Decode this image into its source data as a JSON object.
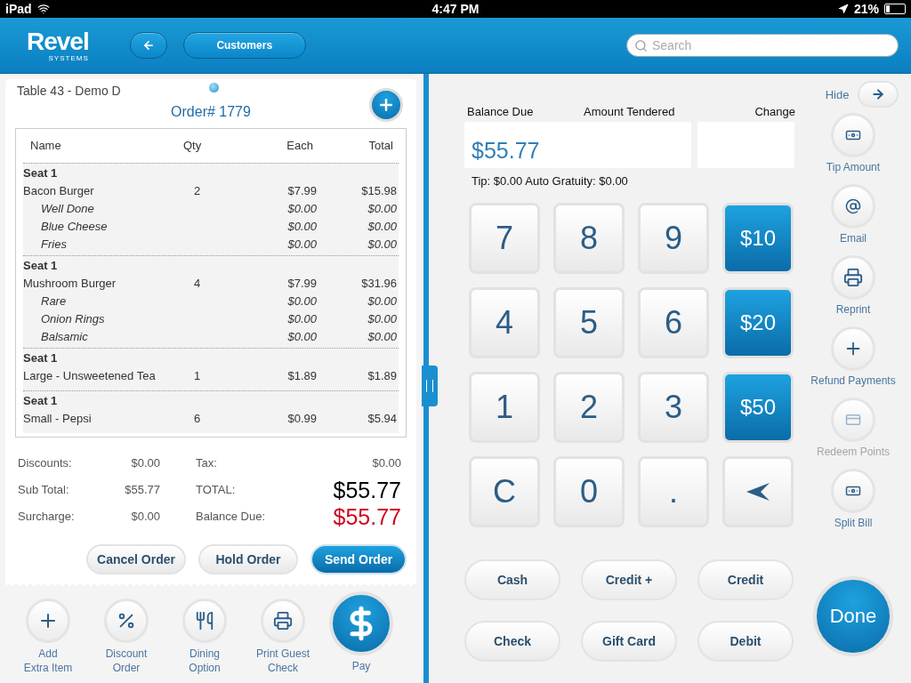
{
  "status_bar": {
    "device": "iPad",
    "time": "4:47 PM",
    "battery": "21%"
  },
  "header": {
    "logo": "Revel",
    "logo_sub": "SYSTEMS",
    "customers_button": "Customers",
    "search": {
      "placeholder": "Search"
    }
  },
  "order": {
    "table": "Table 43 - Demo D",
    "number": "Order# 1779",
    "columns": [
      "Name",
      "Qty",
      "Each",
      "Total"
    ],
    "groups": [
      {
        "seat": "Seat 1",
        "item": {
          "name": "Bacon Burger",
          "qty": "2",
          "each": "$7.99",
          "total": "$15.98"
        },
        "modifiers": [
          {
            "name": "Well Done",
            "each": "$0.00",
            "total": "$0.00"
          },
          {
            "name": "Blue Cheese",
            "each": "$0.00",
            "total": "$0.00"
          },
          {
            "name": "Fries",
            "each": "$0.00",
            "total": "$0.00"
          }
        ]
      },
      {
        "seat": "Seat 1",
        "item": {
          "name": "Mushroom Burger",
          "qty": "4",
          "each": "$7.99",
          "total": "$31.96"
        },
        "modifiers": [
          {
            "name": "Rare",
            "each": "$0.00",
            "total": "$0.00"
          },
          {
            "name": "Onion Rings",
            "each": "$0.00",
            "total": "$0.00"
          },
          {
            "name": "Balsamic",
            "each": "$0.00",
            "total": "$0.00"
          }
        ]
      },
      {
        "seat": "Seat 1",
        "item": {
          "name": "Large - Unsweetened Tea",
          "qty": "1",
          "each": "$1.89",
          "total": "$1.89"
        }
      },
      {
        "seat": "Seat 1",
        "item": {
          "name": "Small - Pepsi",
          "qty": "6",
          "each": "$0.99",
          "total": "$5.94"
        }
      }
    ],
    "summary_left": [
      {
        "label": "Discounts:",
        "value": "$0.00"
      },
      {
        "label": "Sub Total:",
        "value": "$55.77"
      },
      {
        "label": "Surcharge:",
        "value": "$0.00"
      }
    ],
    "summary_right": [
      {
        "label": "Tax:",
        "value": "$0.00",
        "kind": "plain"
      },
      {
        "label": "TOTAL:",
        "value": "$55.77",
        "kind": "total"
      },
      {
        "label": "Balance Due:",
        "value": "$55.77",
        "kind": "due"
      }
    ],
    "buttons": [
      {
        "label": "Cancel Order",
        "kind": "secondary"
      },
      {
        "label": "Hold Order",
        "kind": "secondary"
      },
      {
        "label": "Send Order",
        "kind": "primary"
      }
    ]
  },
  "order_actions": [
    {
      "label": "Add\nExtra Item",
      "kind": "add"
    },
    {
      "label": "Discount\nOrder",
      "kind": "discount"
    },
    {
      "label": "Dining\nOption",
      "kind": "dining"
    },
    {
      "label": "Print Guest\nCheck",
      "kind": "print"
    },
    {
      "label": "Pay",
      "kind": "pay"
    }
  ],
  "payment": {
    "balance_label": "Balance Due",
    "tendered_label": "Amount Tendered",
    "change_label": "Change",
    "amount": "$55.77",
    "tip_line": "Tip: $0.00 Auto Gratuity: $0.00",
    "keys": [
      {
        "label": "7",
        "kind": "digit"
      },
      {
        "label": "8",
        "kind": "digit"
      },
      {
        "label": "9",
        "kind": "digit"
      },
      {
        "label": "$10",
        "kind": "amount"
      },
      {
        "label": "4",
        "kind": "digit"
      },
      {
        "label": "5",
        "kind": "digit"
      },
      {
        "label": "6",
        "kind": "digit"
      },
      {
        "label": "$20",
        "kind": "amount"
      },
      {
        "label": "1",
        "kind": "digit"
      },
      {
        "label": "2",
        "kind": "digit"
      },
      {
        "label": "3",
        "kind": "digit"
      },
      {
        "label": "$50",
        "kind": "amount"
      },
      {
        "label": "C",
        "kind": "digit"
      },
      {
        "label": "0",
        "kind": "digit"
      },
      {
        "label": ".",
        "kind": "digit"
      },
      {
        "kind": "backspace"
      }
    ],
    "methods": [
      "Cash",
      "Credit +",
      "Credit",
      "Check",
      "Gift Card",
      "Debit"
    ],
    "done": "Done"
  },
  "side_actions": {
    "hide": "Hide",
    "items": [
      {
        "label": "Tip Amount",
        "kind": "bills",
        "disabled": false
      },
      {
        "label": "Email",
        "kind": "email",
        "disabled": false
      },
      {
        "label": "Reprint",
        "kind": "print",
        "disabled": false
      },
      {
        "label": "Refund Payments",
        "kind": "plus",
        "disabled": false
      },
      {
        "label": "Redeem Points",
        "kind": "card",
        "disabled": true
      },
      {
        "label": "Split Bill",
        "kind": "bills",
        "disabled": false
      }
    ]
  }
}
